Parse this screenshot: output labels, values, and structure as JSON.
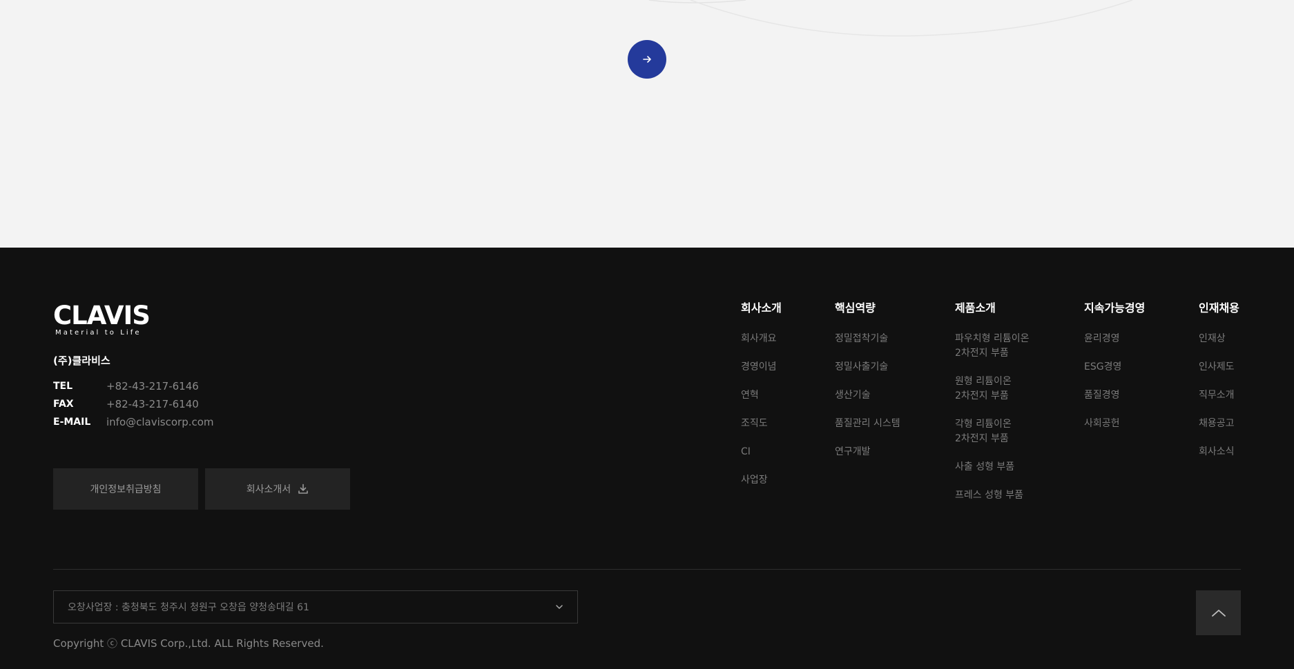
{
  "colors": {
    "accent": "#243a9b",
    "footer_bg": "#111111",
    "top_bg": "#f3f3f3"
  },
  "top": {
    "next_button_icon": "arrow-right-icon"
  },
  "logo": {
    "word": "CLAVIS",
    "tagline": "Material to Life"
  },
  "company": {
    "name": "(주)클라비스",
    "contacts": [
      {
        "label": "TEL",
        "value": "+82-43-217-6146"
      },
      {
        "label": "FAX",
        "value": "+82-43-217-6140"
      },
      {
        "label": "E-MAIL",
        "value": "info@claviscorp.com"
      }
    ]
  },
  "buttons": {
    "privacy": "개인정보취급방침",
    "brochure": "회사소개서",
    "brochure_icon": "download-icon"
  },
  "nav": [
    {
      "title": "회사소개",
      "items": [
        "회사개요",
        "경영이념",
        "연혁",
        "조직도",
        "CI",
        "사업장"
      ]
    },
    {
      "title": "핵심역량",
      "items": [
        "정밀접착기술",
        "정밀사출기술",
        "생산기술",
        "품질관리 시스템",
        "연구개발"
      ]
    },
    {
      "title": "제품소개",
      "items": [
        [
          "파우치형 리튬이온",
          "2차전지 부품"
        ],
        [
          "원형 리튬이온",
          "2차전지 부품"
        ],
        [
          "각형 리튬이온",
          "2차전지 부품"
        ],
        "사출 성형 부품",
        "프레스 성형 부품"
      ]
    },
    {
      "title": "지속가능경영",
      "items": [
        "윤리경영",
        "ESG경영",
        "품질경영",
        "사회공헌"
      ]
    },
    {
      "title": "인재채용",
      "items": [
        "인재상",
        "인사제도",
        "직무소개",
        "채용공고",
        "회사소식"
      ]
    }
  ],
  "site_select": {
    "value": "오창사업장 : 충청북도 청주시 청원구 오창읍 양청송대길 61",
    "icon": "chevron-down-icon"
  },
  "copyright": "Copyright ⓒ CLAVIS Corp.,Ltd. ALL Rights Reserved.",
  "top_button_icon": "chevron-up-icon"
}
